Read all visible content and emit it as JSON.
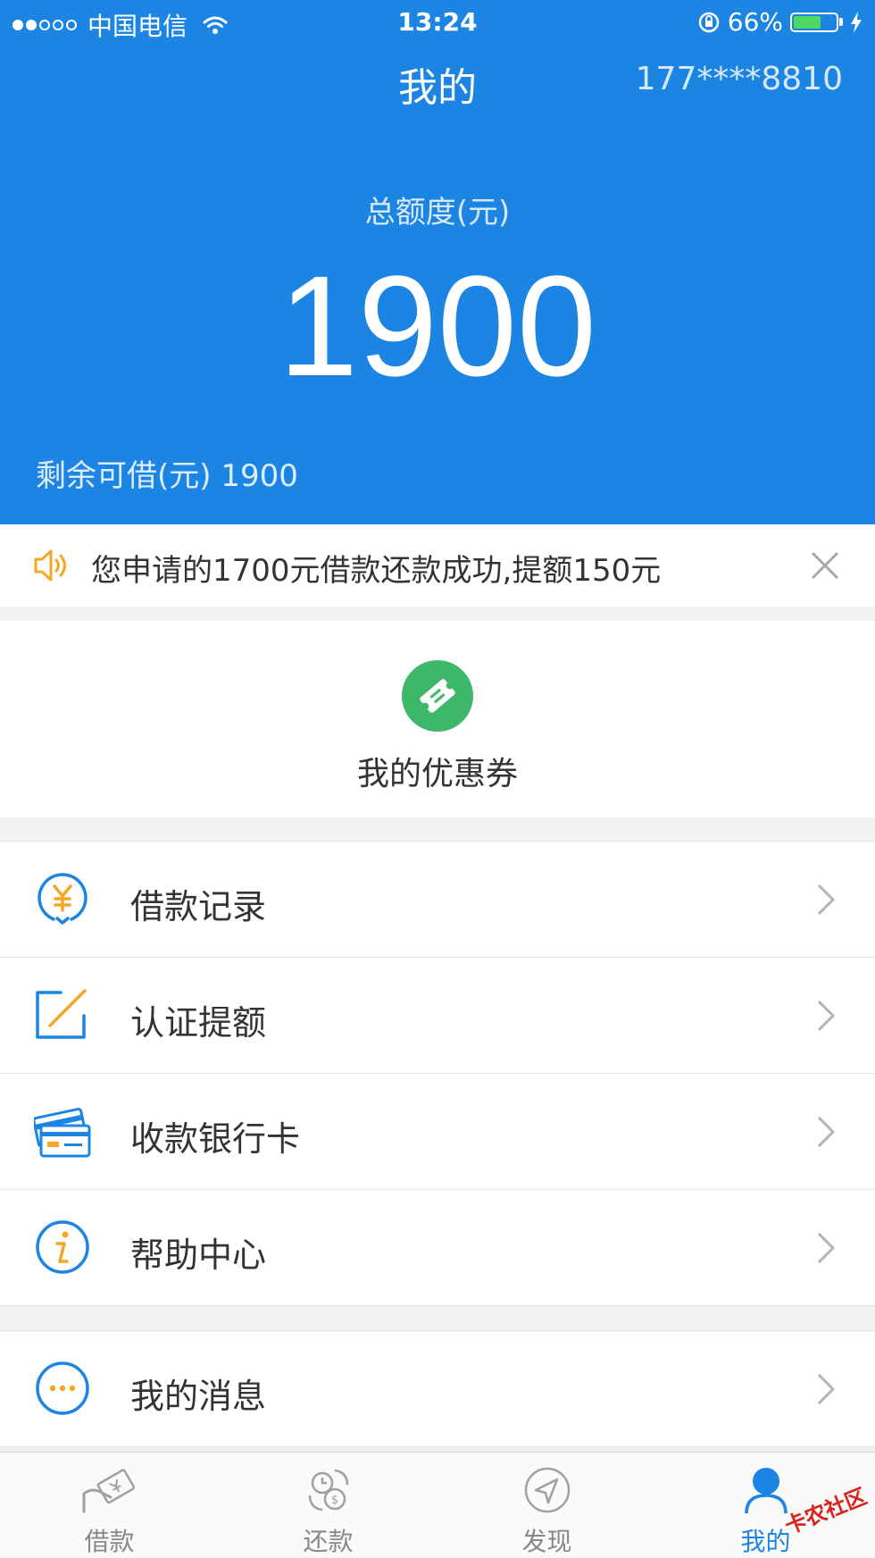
{
  "status_bar": {
    "carrier": "中国电信",
    "time": "13:24",
    "battery_percent": "66%",
    "battery_level": 0.66,
    "signal_bars": 2
  },
  "header": {
    "title": "我的",
    "phone": "177****8810",
    "quota_label": "总额度(元)",
    "quota_value": "1900",
    "remain_text": "剩余可借(元) 1900"
  },
  "notice": {
    "text": "您申请的1700元借款还款成功,提额150元"
  },
  "coupon": {
    "label": "我的优惠券"
  },
  "menu": {
    "items": [
      {
        "label": "借款记录",
        "icon": "yuan-icon"
      },
      {
        "label": "认证提额",
        "icon": "edit-icon"
      },
      {
        "label": "收款银行卡",
        "icon": "bank-card-icon"
      },
      {
        "label": "帮助中心",
        "icon": "info-icon"
      }
    ],
    "messages_label": "我的消息"
  },
  "tabbar": {
    "tabs": [
      {
        "label": "借款",
        "icon": "loan-icon"
      },
      {
        "label": "还款",
        "icon": "repay-icon"
      },
      {
        "label": "发现",
        "icon": "discover-icon"
      },
      {
        "label": "我的",
        "icon": "user-icon"
      }
    ],
    "active_index": 3,
    "watermark": "卡农社区"
  },
  "colors": {
    "primary": "#1c84e3",
    "accent_orange": "#f5a623",
    "coupon_green": "#3db86a",
    "background": "#f2f2f2"
  }
}
